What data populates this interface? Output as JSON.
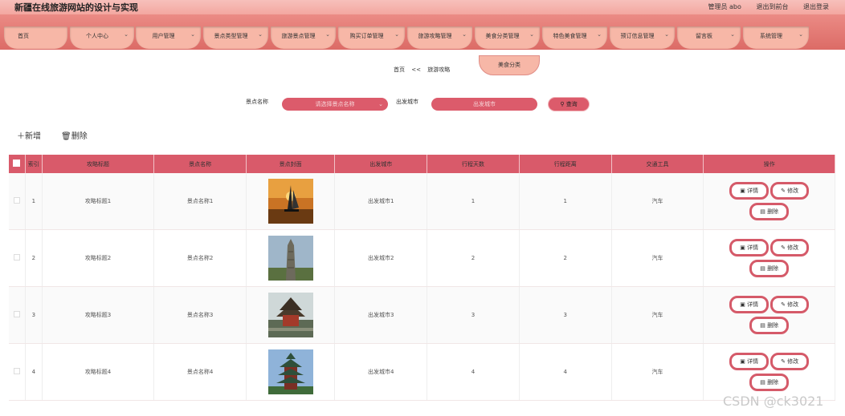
{
  "header": {
    "title": "新疆在线旅游网站的设计与实现",
    "admin_label": "管理员 abo",
    "to_front": "退出到前台",
    "logout": "退出登录"
  },
  "nav": {
    "items": [
      {
        "label": "首页",
        "chevron": false
      },
      {
        "label": "个人中心",
        "chevron": true
      },
      {
        "label": "用户管理",
        "chevron": true
      },
      {
        "label": "景点类型管理",
        "chevron": true
      },
      {
        "label": "旅游景点管理",
        "chevron": true
      },
      {
        "label": "购买订单管理",
        "chevron": true
      },
      {
        "label": "旅游攻略管理",
        "chevron": true
      },
      {
        "label": "美食分类管理",
        "chevron": true
      },
      {
        "label": "特色美食管理",
        "chevron": true
      },
      {
        "label": "预订信息管理",
        "chevron": true
      },
      {
        "label": "留言板",
        "chevron": true
      },
      {
        "label": "系统管理",
        "chevron": true
      }
    ],
    "dropdown_item": "美食分类"
  },
  "breadcrumb": {
    "home": "首页",
    "sep": "<<",
    "current": "旅游攻略"
  },
  "search": {
    "spot_label": "景点名称",
    "spot_placeholder": "请选择景点名称",
    "city_label": "出发城市",
    "city_placeholder": "出发城市",
    "query_btn": "查询"
  },
  "toolbar": {
    "add": "新增",
    "delete": "删除"
  },
  "table": {
    "headers": [
      "索引",
      "攻略标题",
      "景点名称",
      "景点封面",
      "出发城市",
      "行程天数",
      "行程距离",
      "交通工具",
      "操作"
    ],
    "rows": [
      {
        "index": "1",
        "title": "攻略标题1",
        "spot": "景点名称1",
        "image": "sunset-sailboat",
        "city": "出发城市1",
        "days": "1",
        "distance": "1",
        "transport": "汽车"
      },
      {
        "index": "2",
        "title": "攻略标题2",
        "spot": "景点名称2",
        "image": "stone-tower",
        "city": "出发城市2",
        "days": "2",
        "distance": "2",
        "transport": "汽车"
      },
      {
        "index": "3",
        "title": "攻略标题3",
        "spot": "景点名称3",
        "image": "pagoda-aerial",
        "city": "出发城市3",
        "days": "3",
        "distance": "3",
        "transport": "汽车"
      },
      {
        "index": "4",
        "title": "攻略标题4",
        "spot": "景点名称4",
        "image": "pagoda-tower",
        "city": "出发城市4",
        "days": "4",
        "distance": "4",
        "transport": "汽车"
      }
    ],
    "actions": {
      "detail": "详情",
      "edit": "修改",
      "delete": "删除"
    }
  },
  "watermark": "CSDN @ck3021",
  "colors": {
    "accent": "#d95a6a",
    "nav": "#e07872",
    "tab": "#f7b7a7"
  }
}
